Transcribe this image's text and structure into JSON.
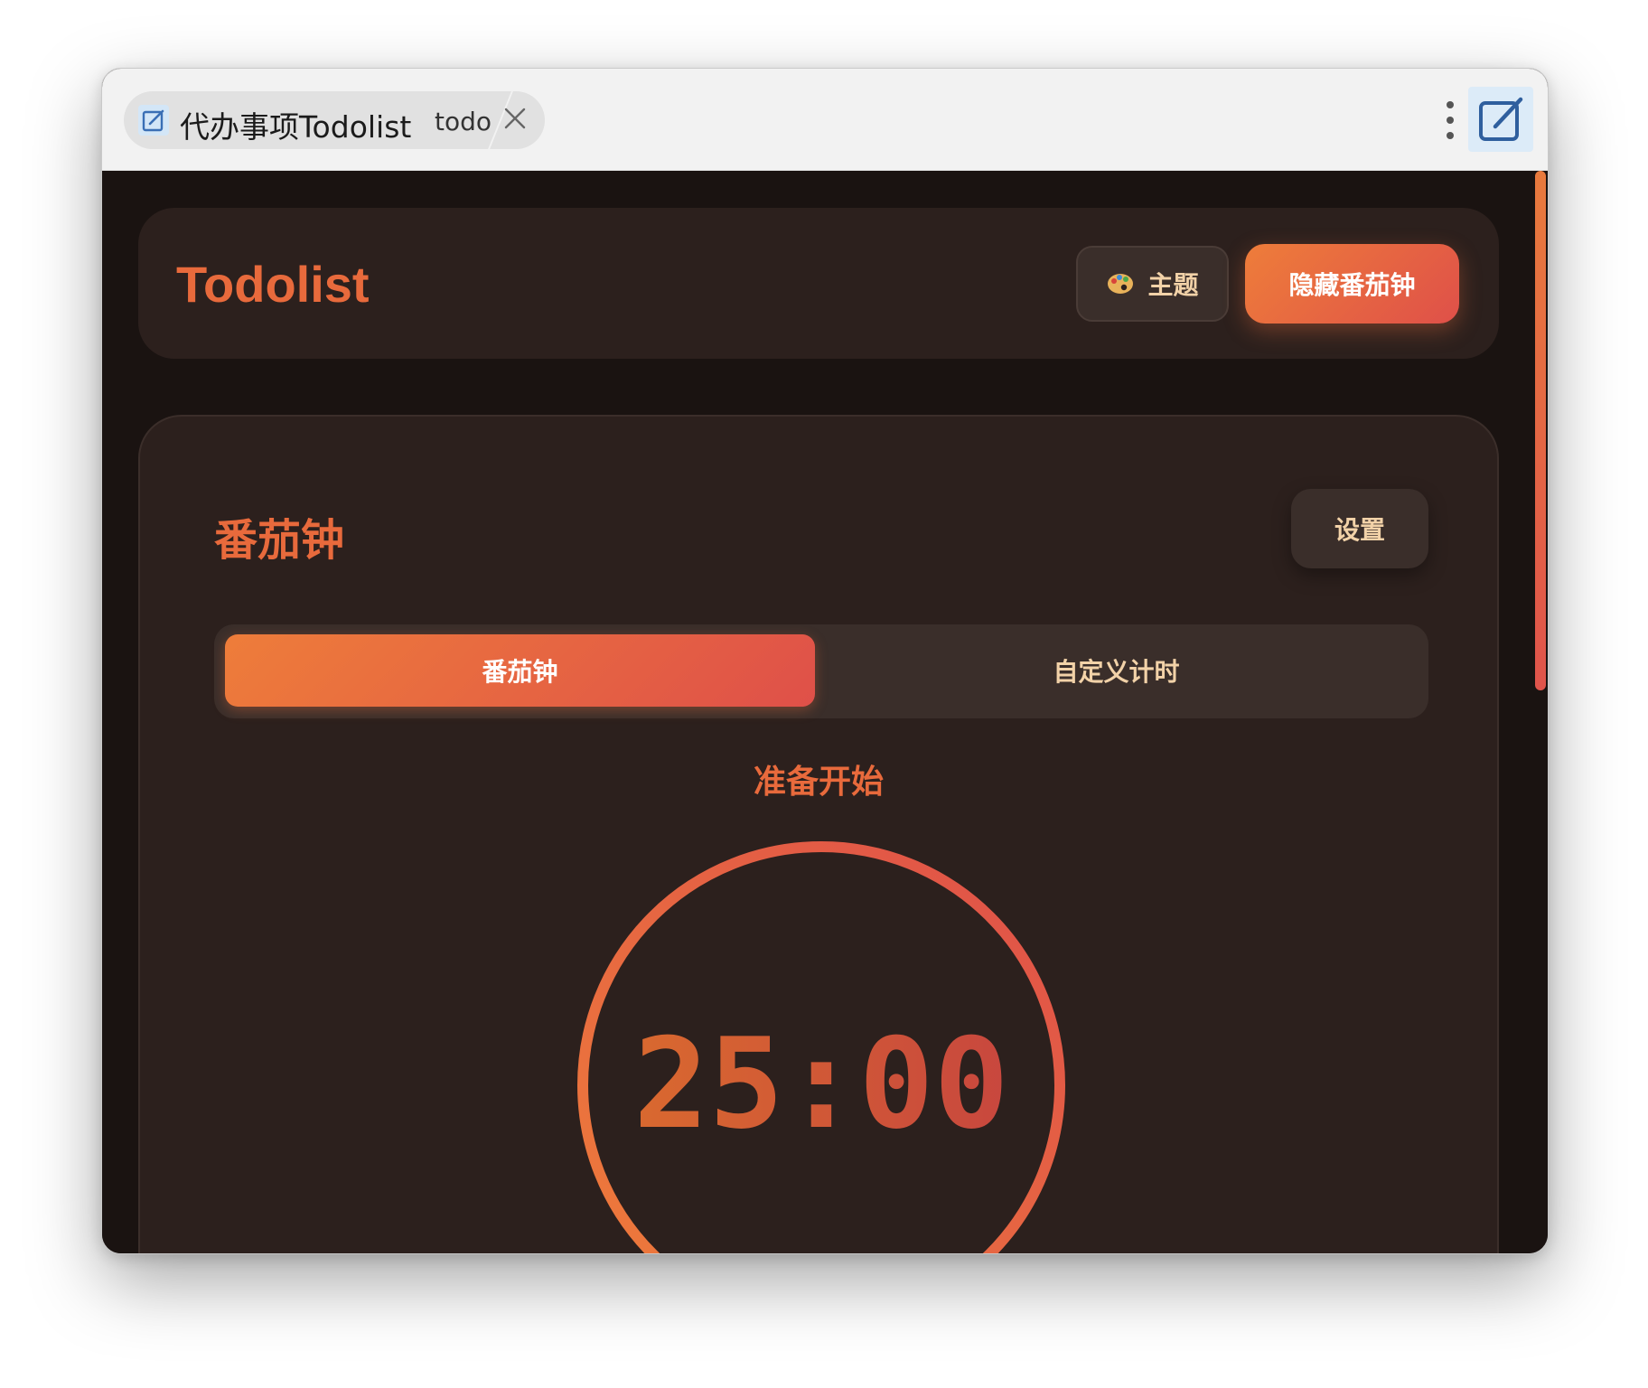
{
  "titlebar": {
    "tab_title": "代办事项Todolist",
    "tab_sub": "todo"
  },
  "header": {
    "app_title": "Todolist",
    "theme_label": "主题",
    "hide_pomodoro_label": "隐藏番茄钟"
  },
  "pomodoro": {
    "title": "番茄钟",
    "settings_label": "设置",
    "modes": [
      "番茄钟",
      "自定义计时"
    ],
    "active_mode": "番茄钟",
    "status": "准备开始",
    "time": "25:00"
  },
  "colors": {
    "accent_start": "#ee7d3a",
    "accent_end": "#df5049",
    "background": "#1a1311",
    "card": "#2c201d",
    "muted_text": "#f2d2a8"
  }
}
